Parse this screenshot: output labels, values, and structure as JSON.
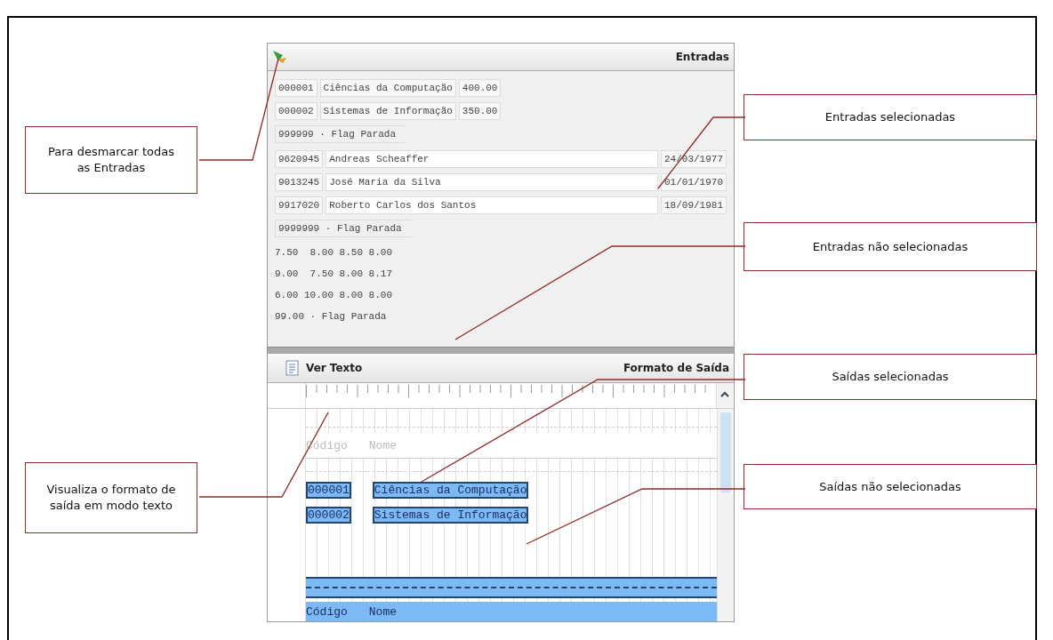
{
  "panel": {
    "inputs": {
      "title": "Entradas",
      "groups": [
        {
          "kind": "compact",
          "rows": [
            {
              "cells": [
                "000001",
                "Ciências da Computação",
                "400.00"
              ]
            },
            {
              "cells": [
                "000002",
                "Sistemas de Informação",
                "350.00"
              ]
            }
          ],
          "stop": "999999 · Flag Parada"
        },
        {
          "kind": "wide",
          "rows": [
            {
              "cells": [
                "9620945",
                "Andreas Scheaffer",
                "24/03/1977"
              ]
            },
            {
              "cells": [
                "9013245",
                "José Maria da Silva",
                "01/01/1970"
              ]
            },
            {
              "cells": [
                "9917020",
                "Roberto Carlos dos Santos",
                "18/09/1981"
              ]
            }
          ],
          "stop": "9999999 · Flag Parada"
        },
        {
          "kind": "plain",
          "rows": [
            {
              "cells": [
                "7.50",
                "8.00",
                "8.50",
                "8.00"
              ]
            },
            {
              "cells": [
                "9.00",
                "7.50",
                "8.00",
                "8.17"
              ]
            },
            {
              "cells": [
                "6.00",
                "10.00",
                "8.00",
                "8.00"
              ]
            }
          ],
          "stop": "99.00 · Flag Parada"
        }
      ]
    },
    "output": {
      "button": "Ver Texto",
      "title": "Formato de Saída",
      "lines": [
        {
          "kind": "rule",
          "selected": false
        },
        {
          "kind": "fields",
          "selected": false,
          "fields": [
            "Código",
            "Nome"
          ]
        },
        {
          "kind": "rule",
          "selected": false
        },
        {
          "kind": "fields",
          "selected": true,
          "fields": [
            "000001",
            "Ciências da Computação"
          ]
        },
        {
          "kind": "fields",
          "selected": true,
          "fields": [
            "000002",
            "Sistemas de Informação"
          ]
        },
        {
          "kind": "gap"
        },
        {
          "kind": "rule",
          "selected": true
        },
        {
          "kind": "band",
          "selected": true,
          "fields": [
            "Código",
            "Nome"
          ]
        }
      ]
    }
  },
  "left_callouts": [
    {
      "text": "Para desmarcar todas as Entradas"
    },
    {
      "text": "Visualiza o formato de saída em modo texto"
    }
  ],
  "right_callouts": [
    {
      "text": "Entradas selecionadas"
    },
    {
      "text": "Entradas não selecionadas"
    },
    {
      "text": "Saídas selecionadas"
    },
    {
      "text": "Saídas não selecionadas"
    }
  ]
}
